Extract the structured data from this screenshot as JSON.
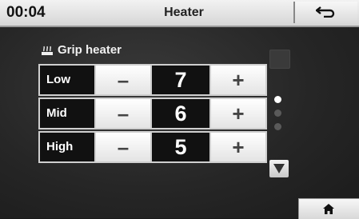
{
  "header": {
    "time": "00:04",
    "title": "Heater",
    "back_icon": "back-arrow-icon"
  },
  "section": {
    "label": "Grip heater",
    "icon": "grip-heater-icon"
  },
  "settings": [
    {
      "label": "Low",
      "value": "7",
      "minus": "–",
      "plus": "+"
    },
    {
      "label": "Mid",
      "value": "6",
      "minus": "–",
      "plus": "+"
    },
    {
      "label": "High",
      "value": "5",
      "minus": "–",
      "plus": "+"
    }
  ],
  "page_indicator": {
    "total": 3,
    "current": 1
  },
  "footer": {
    "home_icon": "home-icon"
  },
  "colors": {
    "indicator_active": "#ffffff",
    "indicator_inactive": "#5a5a5a"
  }
}
